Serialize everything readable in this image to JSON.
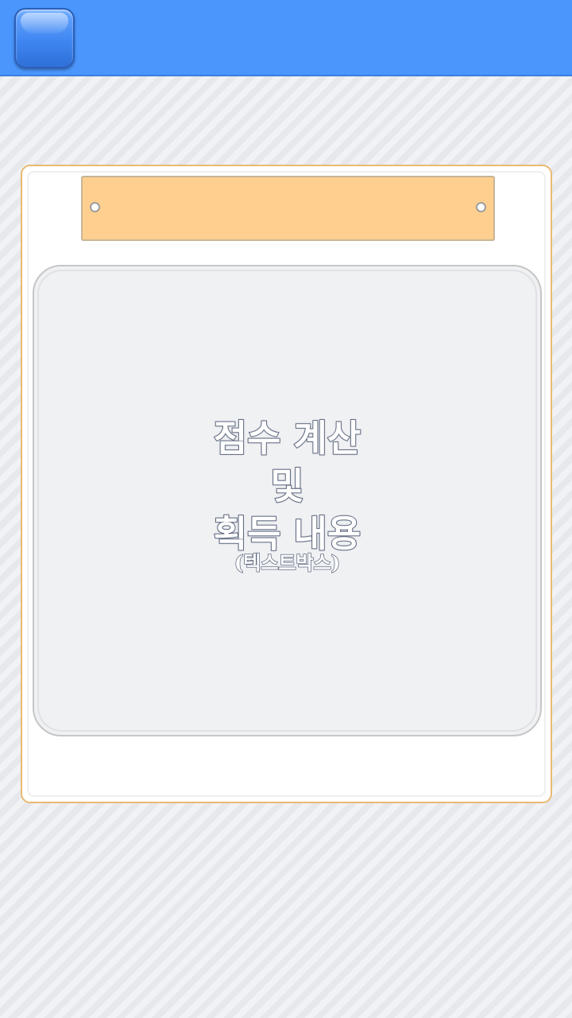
{
  "header": {
    "background_color": "#4a96fd",
    "menu_button_icon": "rounded-square-button-icon"
  },
  "board": {
    "border_color": "#e9b970",
    "nameplate": {
      "title": "",
      "color": "#ffcf8f"
    },
    "text_panel": {
      "lines": [
        "점수 계산",
        "및",
        "획득 내용"
      ],
      "caption": "(텍스트박스)"
    }
  }
}
